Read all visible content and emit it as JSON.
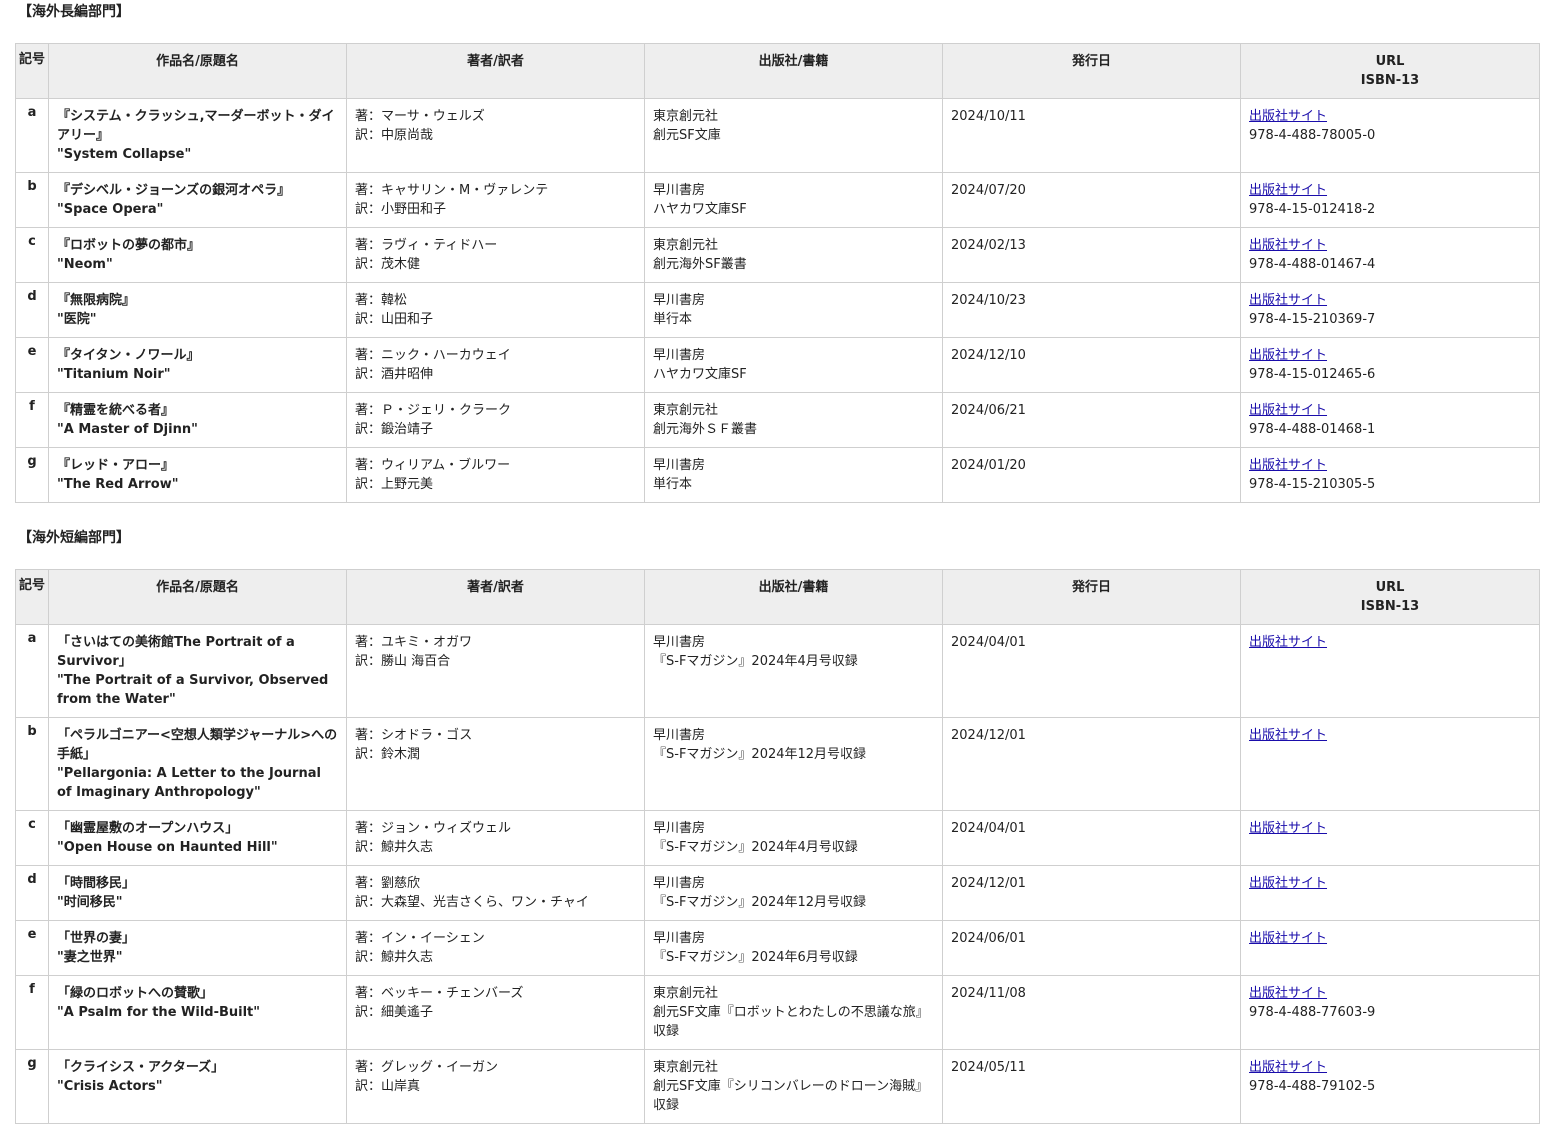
{
  "long_section": {
    "title": "【海外長編部門】",
    "headers": {
      "code": "記号",
      "title": "作品名/原題名",
      "author": "著者/訳者",
      "publisher": "出版社/書籍",
      "date": "発行日",
      "url_line1": "URL",
      "url_line2": "ISBN-13"
    },
    "rows": [
      {
        "code": "a",
        "title_ja": "『システム・クラッシュ,マーダーボット・ダイアリー』",
        "title_en": "\"System Collapse\"",
        "author": "著：マーサ・ウェルズ",
        "translator": "訳：中原尚哉",
        "publisher": "東京創元社",
        "book": "創元SF文庫",
        "date": "2024/10/11",
        "link": "出版社サイト",
        "isbn": "978-4-488-78005-0"
      },
      {
        "code": "b",
        "title_ja": "『デシベル・ジョーンズの銀河オペラ』",
        "title_en": "\"Space Opera\"",
        "author": "著：キャサリン・M・ヴァレンテ",
        "translator": "訳：小野田和子",
        "publisher": "早川書房",
        "book": "ハヤカワ文庫SF",
        "date": "2024/07/20",
        "link": "出版社サイト",
        "isbn": "978-4-15-012418-2"
      },
      {
        "code": "c",
        "title_ja": "『ロボットの夢の都市』",
        "title_en": "\"Neom\"",
        "author": "著：ラヴィ・ティドハー",
        "translator": "訳：茂木健",
        "publisher": "東京創元社",
        "book": "創元海外SF叢書",
        "date": "2024/02/13",
        "link": "出版社サイト",
        "isbn": "978-4-488-01467-4"
      },
      {
        "code": "d",
        "title_ja": "『無限病院』",
        "title_en": "\"医院\"",
        "author": "著：韓松",
        "translator": "訳：山田和子",
        "publisher": "早川書房",
        "book": "単行本",
        "date": "2024/10/23",
        "link": "出版社サイト",
        "isbn": "978-4-15-210369-7"
      },
      {
        "code": "e",
        "title_ja": "『タイタン・ノワール』",
        "title_en": "\"Titanium Noir\"",
        "author": "著：ニック・ハーカウェイ",
        "translator": "訳：酒井昭伸",
        "publisher": "早川書房",
        "book": "ハヤカワ文庫SF",
        "date": "2024/12/10",
        "link": "出版社サイト",
        "isbn": "978-4-15-012465-6"
      },
      {
        "code": "f",
        "title_ja": "『精霊を統べる者』",
        "title_en": "\"A Master of Djinn\"",
        "author": "著：Ｐ・ジェリ・クラーク",
        "translator": "訳：鍛治靖子",
        "publisher": "東京創元社",
        "book": "創元海外ＳＦ叢書",
        "date": "2024/06/21",
        "link": "出版社サイト",
        "isbn": "978-4-488-01468-1"
      },
      {
        "code": "g",
        "title_ja": "『レッド・アロー』",
        "title_en": "\"The Red Arrow\"",
        "author": "著：ウィリアム・ブルワー",
        "translator": "訳：上野元美",
        "publisher": "早川書房",
        "book": "単行本",
        "date": "2024/01/20",
        "link": "出版社サイト",
        "isbn": "978-4-15-210305-5"
      }
    ]
  },
  "short_section": {
    "title": "【海外短編部門】",
    "headers": {
      "code": "記号",
      "title": "作品名/原題名",
      "author": "著者/訳者",
      "publisher": "出版社/書籍",
      "date": "発行日",
      "url_line1": "URL",
      "url_line2": "ISBN-13"
    },
    "rows": [
      {
        "code": "a",
        "title_ja": "「さいはての美術館The Portrait of a Survivor」",
        "title_en": "\"The Portrait of a Survivor, Observed from the Water\"",
        "author": "著：ユキミ・オガワ",
        "translator": "訳：勝山 海百合",
        "publisher": "早川書房",
        "book": "『S-Fマガジン』2024年4月号収録",
        "date": "2024/04/01",
        "link": "出版社サイト",
        "isbn": ""
      },
      {
        "code": "b",
        "title_ja": "「ペラルゴニアー<空想人類学ジャーナル>への手紙」",
        "title_en": "\"Pellargonia: A Letter to the Journal of Imaginary Anthropology\"",
        "author": "著：シオドラ・ゴス",
        "translator": "訳：鈴木潤",
        "publisher": "早川書房",
        "book": "『S-Fマガジン』2024年12月号収録",
        "date": "2024/12/01",
        "link": "出版社サイト",
        "isbn": ""
      },
      {
        "code": "c",
        "title_ja": "「幽霊屋敷のオープンハウス」",
        "title_en": "\"Open House on Haunted Hill\"",
        "author": "著：ジョン・ウィズウェル",
        "translator": "訳：鯨井久志",
        "publisher": "早川書房",
        "book": "『S-Fマガジン』2024年4月号収録",
        "date": "2024/04/01",
        "link": "出版社サイト",
        "isbn": ""
      },
      {
        "code": "d",
        "title_ja": "「時間移民」",
        "title_en": "\"时间移民\"",
        "author": "著：劉慈欣",
        "translator": "訳：大森望、光吉さくら、ワン・チャイ",
        "publisher": "早川書房",
        "book": "『S-Fマガジン』2024年12月号収録",
        "date": "2024/12/01",
        "link": "出版社サイト",
        "isbn": ""
      },
      {
        "code": "e",
        "title_ja": "「世界の妻」",
        "title_en": "\"妻之世界\"",
        "author": "著：イン・イーシェン",
        "translator": "訳：鯨井久志",
        "publisher": "早川書房",
        "book": "『S-Fマガジン』2024年6月号収録",
        "date": "2024/06/01",
        "link": "出版社サイト",
        "isbn": ""
      },
      {
        "code": "f",
        "title_ja": "「緑のロボットへの賛歌」",
        "title_en": "\"A Psalm for the Wild-Built\"",
        "author": "著：ベッキー・チェンバーズ",
        "translator": "訳：細美遙子",
        "publisher": "東京創元社",
        "book": "創元SF文庫『ロボットとわたしの不思議な旅』収録",
        "date": "2024/11/08",
        "link": "出版社サイト",
        "isbn": "978-4-488-77603-9"
      },
      {
        "code": "g",
        "title_ja": "「クライシス・アクターズ」",
        "title_en": "\"Crisis Actors\"",
        "author": "著：グレッグ・イーガン",
        "translator": "訳：山岸真",
        "publisher": "東京創元社",
        "book": "創元SF文庫『シリコンバレーのドローン海賊』収録",
        "date": "2024/05/11",
        "link": "出版社サイト",
        "isbn": "978-4-488-79102-5"
      }
    ]
  },
  "colors": {
    "header_bg": "#eeeeee",
    "border": "#cfcfcf",
    "link": "#1a0dab"
  }
}
